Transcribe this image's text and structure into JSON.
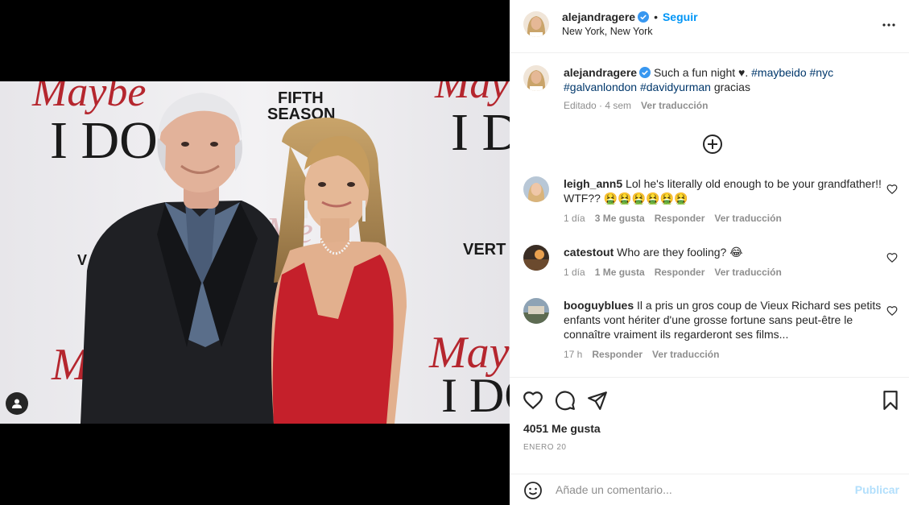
{
  "post": {
    "author": "alejandragere",
    "follow_label": "Seguir",
    "location": "New York, New York",
    "caption_text": "Such a fun night ♥.",
    "caption_tags": [
      "#maybeido",
      "#nyc",
      "#galvanlondon",
      "#davidyurman"
    ],
    "caption_tail": "gracias",
    "caption_meta": {
      "edited": "Editado · 4 sem",
      "translate": "Ver traducción"
    },
    "photo_text": {
      "maybe": "Maybe",
      "ido": "I DO",
      "fifth": "FIFTH",
      "season": "SEASON",
      "vert": "VERT"
    }
  },
  "comments": [
    {
      "user": "leigh_ann5",
      "text": "Lol he's literally old enough to be your grandfather!! WTF?? 🤮🤮🤮🤮🤮🤮",
      "time": "1 día",
      "likes": "3 Me gusta",
      "reply": "Responder",
      "translate": "Ver traducción"
    },
    {
      "user": "catestout",
      "text": "Who are they fooling? 😂",
      "time": "1 día",
      "likes": "1 Me gusta",
      "reply": "Responder",
      "translate": "Ver traducción"
    },
    {
      "user": "booguyblues",
      "text": "Il a pris un gros coup de Vieux Richard ses petits enfants vont hériter d'une grosse fortune sans peut-être le connaître vraiment ils regarderont ses films...",
      "time": "17 h",
      "reply": "Responder",
      "translate": "Ver traducción"
    }
  ],
  "footer": {
    "likes_count": "4051 Me gusta",
    "date": "ENERO 20",
    "comment_placeholder": "Añade un comentario...",
    "publish_label": "Publicar"
  },
  "icons": {
    "heart": "heart-icon",
    "comment": "comment-icon",
    "share": "paper-plane-icon",
    "save": "bookmark-icon",
    "more": "more-options-icon",
    "add": "plus-circle-icon",
    "emoji": "smiley-icon",
    "tag": "user-tag-icon",
    "verified": "verified-badge-icon"
  },
  "colors": {
    "accent": "#0095f6",
    "verified": "#3897f0",
    "hashtag": "#00376b",
    "muted": "#8e8e8e",
    "publish_disabled": "#b2dffc"
  }
}
